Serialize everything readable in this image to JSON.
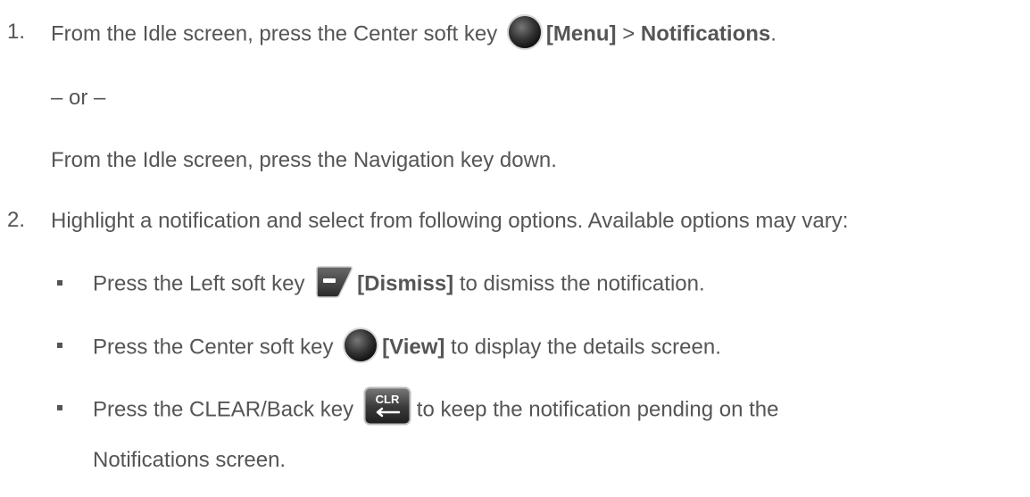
{
  "steps": [
    {
      "number": "1.",
      "text_before": "From the Idle screen, press the Center soft key",
      "key_label": "[Menu]",
      "separator": " > ",
      "target": "Notifications",
      "end": ".",
      "or": "– or –",
      "alternative": "From the Idle screen, press the Navigation key down."
    },
    {
      "number": "2.",
      "text": "Highlight a notification and select from following options. Available options may vary:"
    }
  ],
  "options": [
    {
      "before": "Press the Left soft key",
      "key_label": "[Dismiss]",
      "after": " to dismiss the notification.",
      "icon": "left-soft-key-icon"
    },
    {
      "before": "Press the Center soft key",
      "key_label": "[View]",
      "after": " to display the details screen.",
      "icon": "center-soft-key-icon"
    },
    {
      "before": "Press the CLEAR/Back key",
      "after": "to keep the notification pending on the",
      "after_line2": "Notifications screen.",
      "icon": "clear-back-key-icon",
      "clr_text": "CLR"
    }
  ],
  "colors": {
    "text": "#555555",
    "background": "#ffffff"
  }
}
